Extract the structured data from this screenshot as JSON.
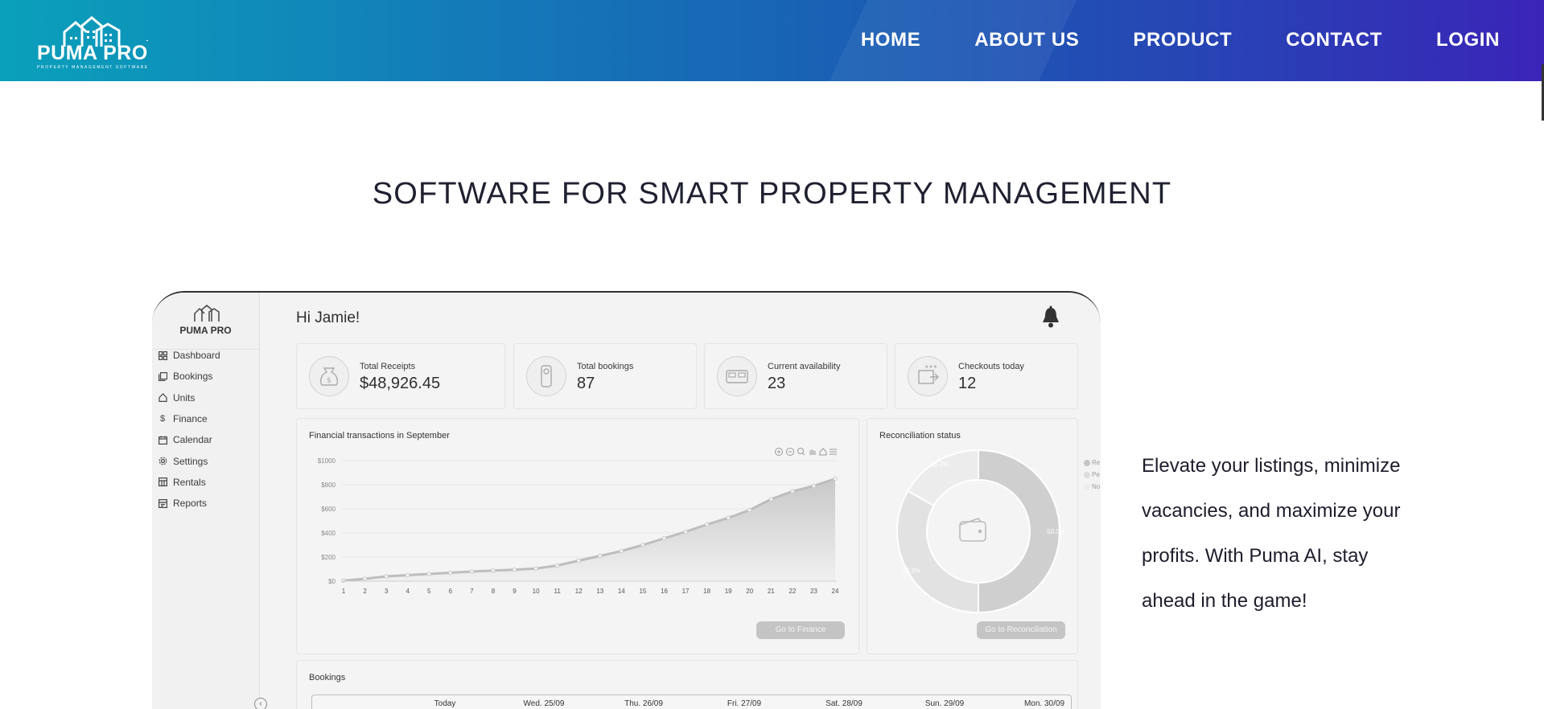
{
  "header": {
    "logo_text": "PUMA PRO",
    "logo_subtitle": "PROPERTY MANAGEMENT SOFTWARE",
    "nav": [
      "HOME",
      "ABOUT US",
      "PRODUCT",
      "CONTACT",
      "LOGIN"
    ]
  },
  "hero": {
    "title": "SOFTWARE FOR SMART PROPERTY MANAGEMENT",
    "tagline": "Elevate your listings, minimize vacancies, and maximize your profits. With Puma AI, stay ahead in the game!"
  },
  "dashboard": {
    "logo_text": "PUMA PRO",
    "greeting": "Hi Jamie!",
    "menu": [
      {
        "label": "Dashboard",
        "icon": "grid-icon"
      },
      {
        "label": "Bookings",
        "icon": "bookings-icon"
      },
      {
        "label": "Units",
        "icon": "home-icon"
      },
      {
        "label": "Finance",
        "icon": "dollar-icon"
      },
      {
        "label": "Calendar",
        "icon": "calendar-icon"
      },
      {
        "label": "Settings",
        "icon": "gear-icon"
      },
      {
        "label": "Rentals",
        "icon": "rentals-icon"
      },
      {
        "label": "Reports",
        "icon": "reports-icon"
      }
    ],
    "stats": [
      {
        "label": "Total Receipts",
        "value": "$48,926.45",
        "icon": "money-bag-icon"
      },
      {
        "label": "Total bookings",
        "value": "87",
        "icon": "door-hanger-icon"
      },
      {
        "label": "Current availability",
        "value": "23",
        "icon": "bed-icon"
      },
      {
        "label": "Checkouts today",
        "value": "12",
        "icon": "checkout-icon"
      }
    ],
    "finance": {
      "title": "Financial transactions in September",
      "button": "Go to Finance"
    },
    "reconciliation": {
      "title": "Reconciliation status",
      "button": "Go to Reconciliation",
      "legend": [
        "Re",
        "Pe",
        "No"
      ]
    },
    "bookings": {
      "title": "Bookings",
      "columns": [
        "Today",
        "Wed. 25/09",
        "Thu. 26/09",
        "Fri. 27/09",
        "Sat. 28/09",
        "Sun. 29/09",
        "Mon. 30/09"
      ]
    }
  },
  "chart_data": [
    {
      "type": "area",
      "title": "Financial transactions in September",
      "x": [
        1,
        2,
        3,
        4,
        5,
        6,
        7,
        8,
        9,
        10,
        11,
        12,
        13,
        14,
        15,
        16,
        17,
        18,
        19,
        20,
        21,
        22,
        23,
        24
      ],
      "series": [
        {
          "values": [
            5,
            20,
            40,
            50,
            60,
            70,
            80,
            88,
            95,
            105,
            130,
            170,
            210,
            250,
            300,
            355,
            410,
            470,
            525,
            590,
            680,
            745,
            790,
            850
          ]
        }
      ],
      "ylim": [
        0,
        1000
      ],
      "yticks": [
        "$0",
        "$200",
        "$400",
        "$600",
        "$800",
        "$1000"
      ],
      "xlabel": "",
      "ylabel": "",
      "colors": {
        "fill": "#cfcfcf",
        "line": "#bdbdbd"
      }
    },
    {
      "type": "pie",
      "title": "Reconciliation status",
      "labels": [
        "Re",
        "Pe",
        "No"
      ],
      "values": [
        50.0,
        33.3,
        16.7
      ],
      "value_labels": [
        "50.0%",
        "33.3%",
        "16.7%"
      ],
      "colors": [
        "#cfcfcf",
        "#e2e2e2",
        "#ececec"
      ]
    }
  ]
}
